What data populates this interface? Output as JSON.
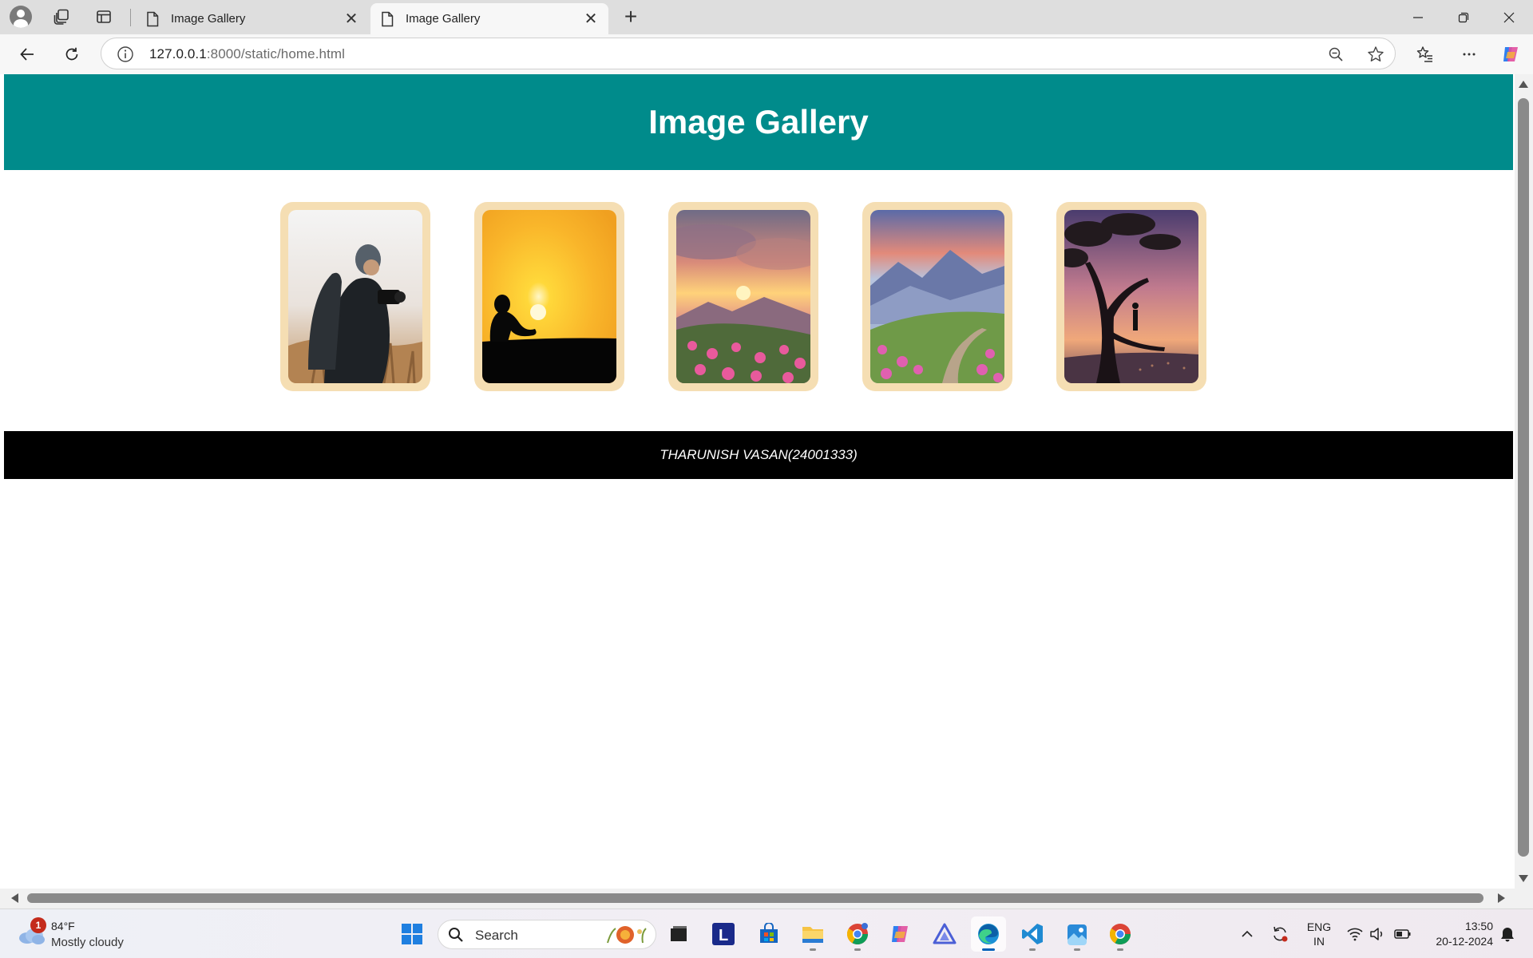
{
  "browser": {
    "tabs": [
      {
        "title": "Image Gallery",
        "active": false
      },
      {
        "title": "Image Gallery",
        "active": true
      }
    ],
    "address": {
      "host": "127.0.0.1",
      "path": ":8000/static/home.html"
    }
  },
  "page": {
    "title": "Image Gallery",
    "footer": "THARUNISH VASAN(24001333)",
    "gallery": [
      {
        "subject": "photographer-with-camera"
      },
      {
        "subject": "silhouette-at-sunset"
      },
      {
        "subject": "mountain-sunset-flowers"
      },
      {
        "subject": "mountain-path-flowers"
      },
      {
        "subject": "man-standing-on-tree"
      }
    ],
    "colors": {
      "header": "#008b8b",
      "footer": "#000000",
      "card_frame": "#f5deb3"
    }
  },
  "taskbar": {
    "weather": {
      "badge": "1",
      "temp": "84°F",
      "condition": "Mostly cloudy"
    },
    "search_placeholder": "Search",
    "lang": {
      "line1": "ENG",
      "line2": "IN"
    },
    "clock": {
      "time": "13:50",
      "date": "20-12-2024"
    },
    "apps": [
      "start",
      "search",
      "task-view",
      "lens",
      "store",
      "file-explorer",
      "chrome-profile",
      "copilot",
      "affinity",
      "edge",
      "vscode",
      "photos",
      "chrome"
    ]
  }
}
